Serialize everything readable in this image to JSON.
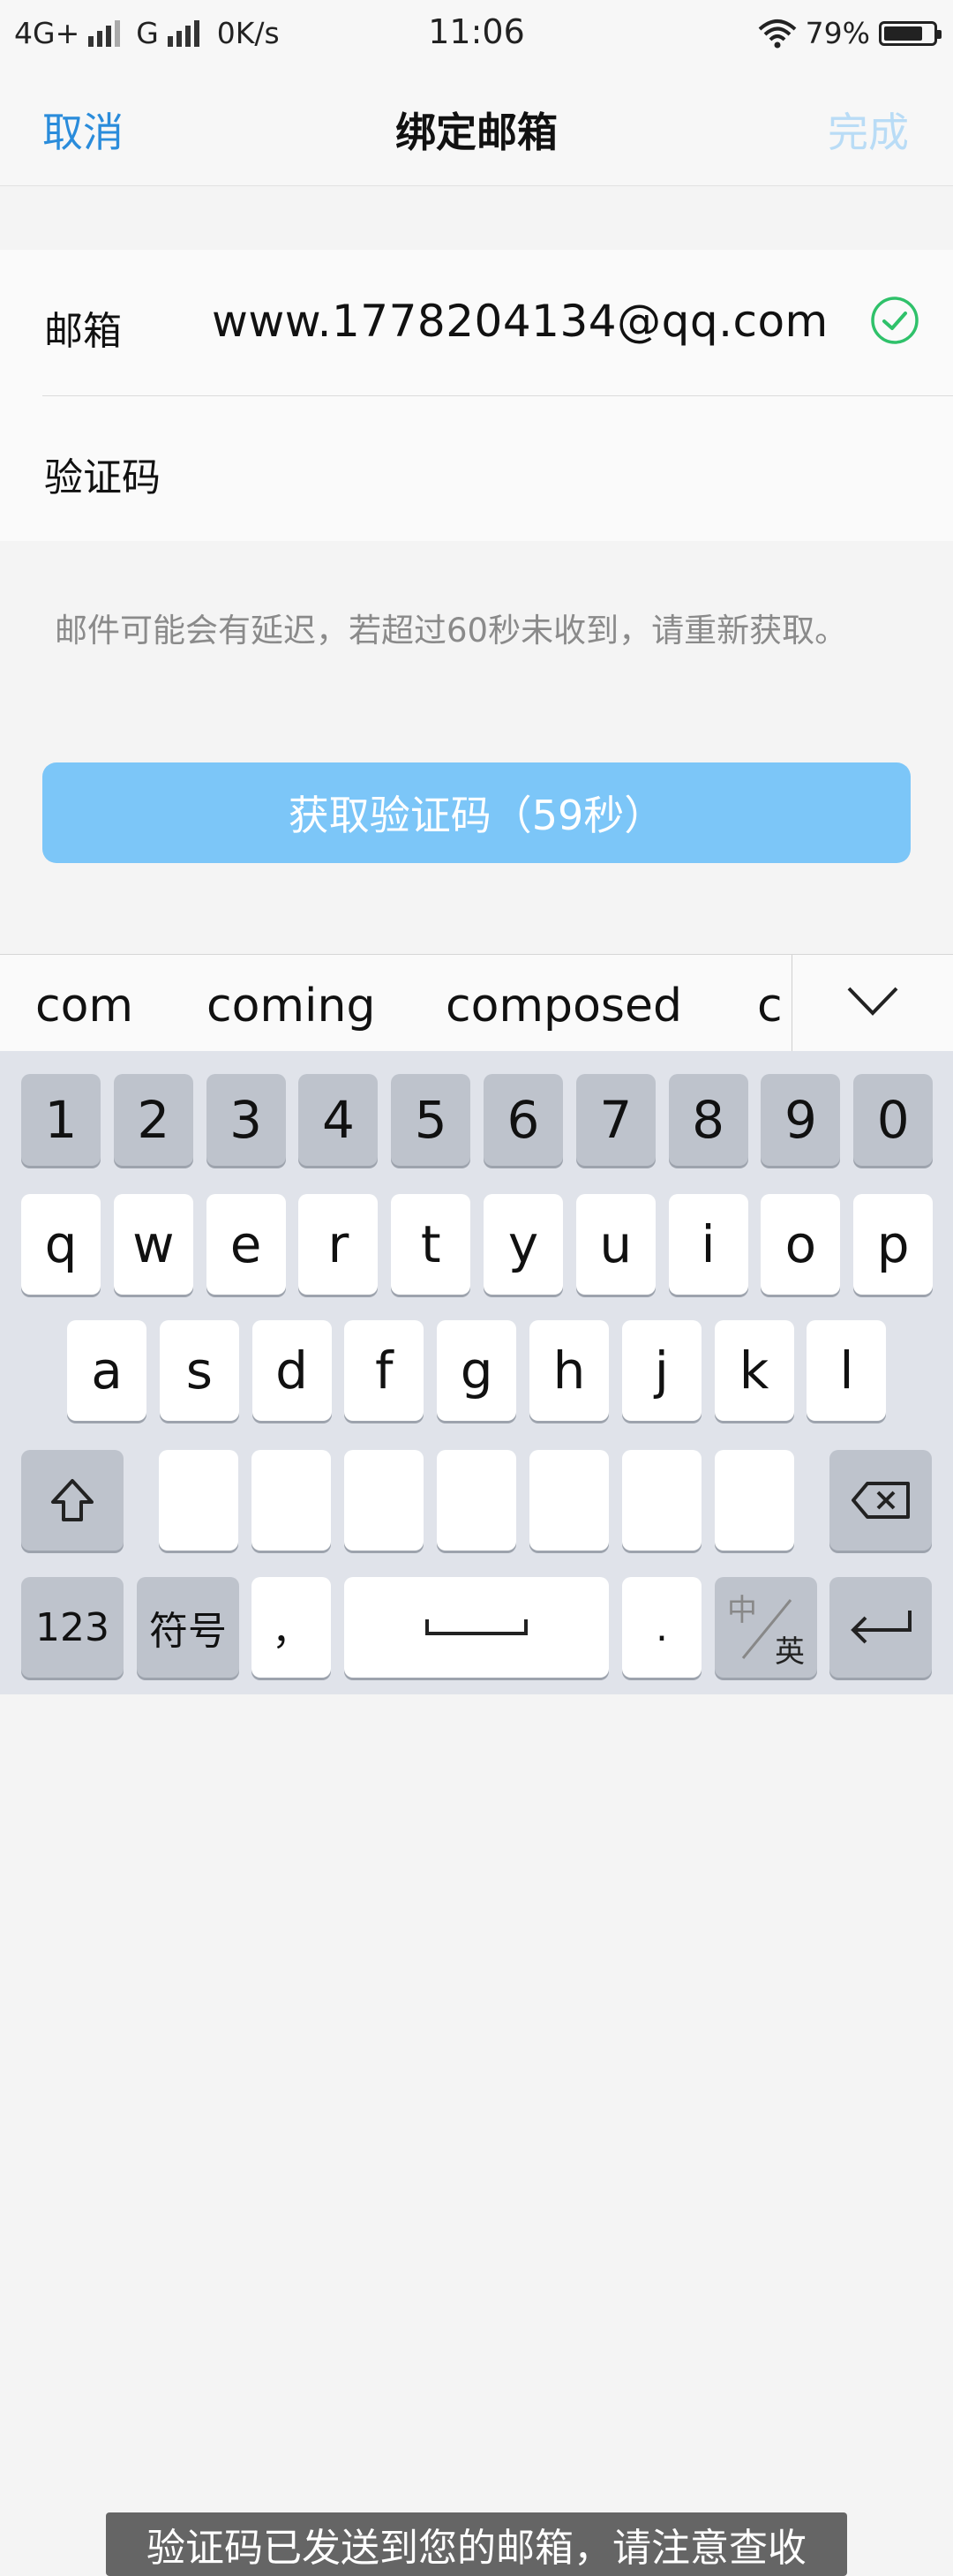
{
  "status_bar": {
    "network1": "4G+",
    "network2": "G",
    "speed": "0K/s",
    "time": "11:06",
    "battery": "79%",
    "battery_level": 0.79
  },
  "nav": {
    "cancel": "取消",
    "title": "绑定邮箱",
    "done": "完成"
  },
  "form": {
    "email_label": "邮箱",
    "email_value": "www.1778204134@qq.com",
    "code_label": "验证码",
    "code_value": ""
  },
  "hint": "邮件可能会有延迟，若超过60秒未收到，请重新获取。",
  "get_code_button": "获取验证码（59秒）",
  "suggestions": [
    "com",
    "coming",
    "composed",
    "c"
  ],
  "keyboard": {
    "numbers": [
      "1",
      "2",
      "3",
      "4",
      "5",
      "6",
      "7",
      "8",
      "9",
      "0"
    ],
    "row1": [
      "q",
      "w",
      "e",
      "r",
      "t",
      "y",
      "u",
      "i",
      "o",
      "p"
    ],
    "row2": [
      "a",
      "s",
      "d",
      "f",
      "g",
      "h",
      "j",
      "k",
      "l"
    ],
    "num_key": "123",
    "symbol_key": "符号",
    "comma_key": "，",
    "period_key": ".",
    "lang_zh": "中",
    "lang_en": "英"
  },
  "toast": "验证码已发送到您的邮箱，请注意查收",
  "colors": {
    "accent": "#2a8cdb",
    "button": "#7cc6f8",
    "check": "#2fc16a"
  }
}
